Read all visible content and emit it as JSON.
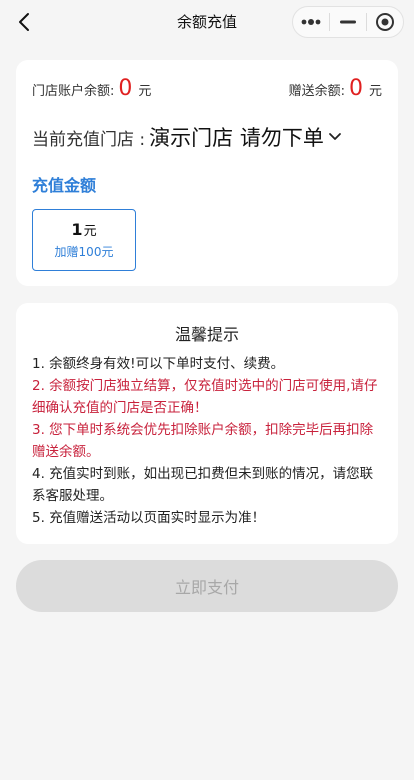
{
  "nav": {
    "title": "余额充值"
  },
  "balance": {
    "store_label": "门店账户余额:",
    "store_value": "0",
    "store_unit": "元",
    "gift_label": "赠送余额:",
    "gift_value": "0",
    "gift_unit": "元"
  },
  "store": {
    "label": "当前充值门店 :",
    "name": "演示门店 请勿下单"
  },
  "recharge": {
    "section_title": "充值金额",
    "options": [
      {
        "amount": "1",
        "unit": "元",
        "bonus": "加赠100元"
      }
    ]
  },
  "tips": {
    "title": "温馨提示",
    "items": [
      "1. 余额终身有效!可以下单时支付、续费。",
      "2. 余额按门店独立结算，仅充值时选中的门店可使用,请仔细确认充值的门店是否正确！",
      "3. 您下单时系统会优先扣除账户余额，扣除完毕后再扣除赠送余额。",
      "4. 充值实时到账，如出现已扣费但未到账的情况，请您联系客服处理。",
      "5. 充值赠送活动以页面实时显示为准！"
    ]
  },
  "pay_button": {
    "label": "立即支付"
  },
  "colors": {
    "accent": "#2f7fd8",
    "warning": "#c8223c",
    "balance_value": "#e02020",
    "button_disabled": "#dcdcdc"
  }
}
